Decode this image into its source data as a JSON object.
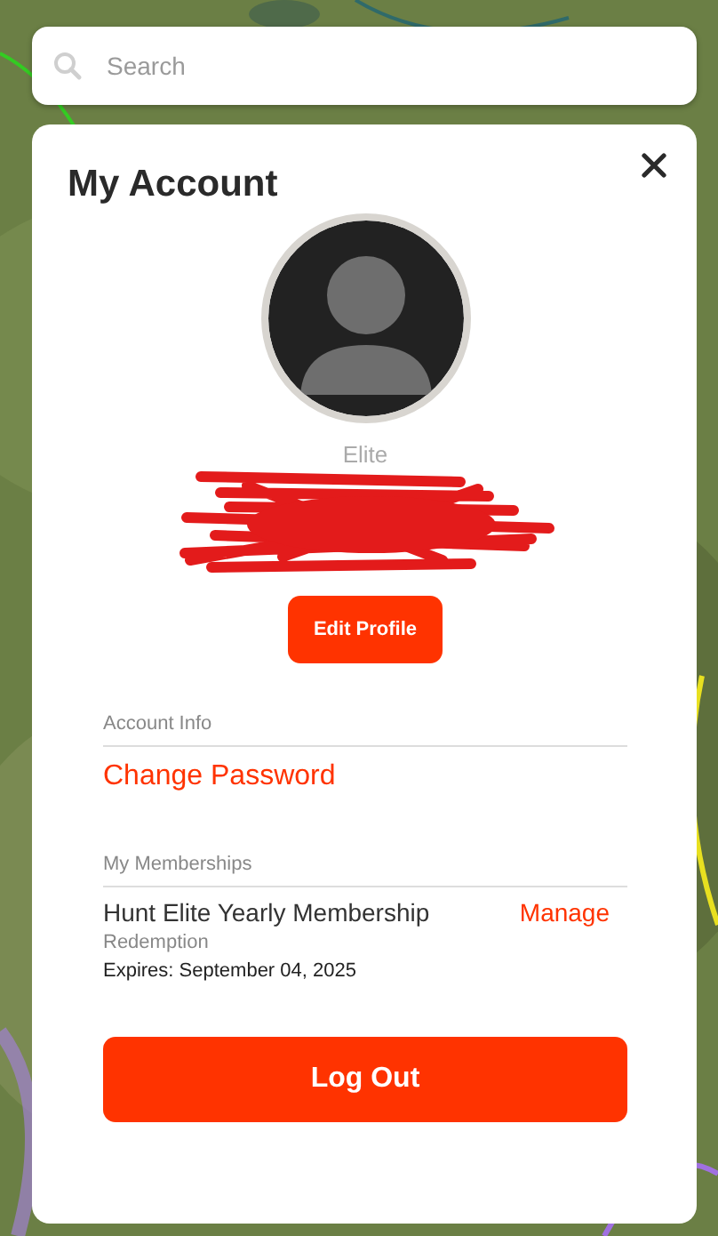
{
  "search": {
    "placeholder": "Search"
  },
  "account_panel": {
    "title": "My Account",
    "tier": "Elite",
    "name_redacted": true,
    "edit_button": "Edit Profile",
    "sections": [
      {
        "kind": "links",
        "heading": "Account Info",
        "links": [
          "Change Password"
        ]
      },
      {
        "kind": "memberships",
        "heading": "My Memberships",
        "memberships": [
          {
            "name": "Hunt Elite Yearly Membership",
            "action": "Manage",
            "source": "Redemption",
            "expires": "Expires: September 04, 2025"
          }
        ]
      }
    ],
    "logout_button": "Log Out"
  }
}
